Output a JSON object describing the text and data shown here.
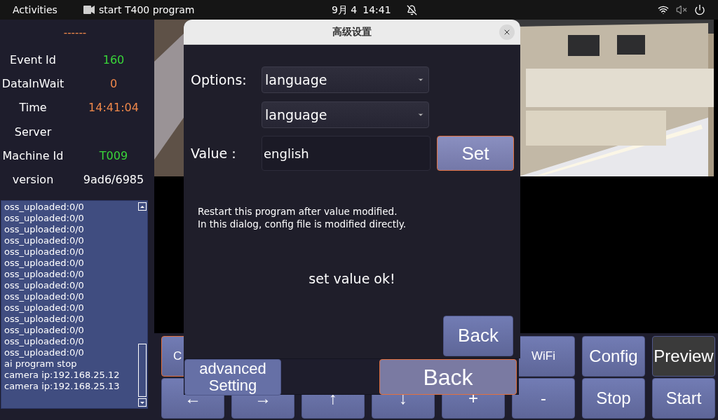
{
  "top_bar": {
    "activities": "Activities",
    "app_title": "start T400 program",
    "date": "9月 4",
    "time": "14:41"
  },
  "status_panel": {
    "header": "------",
    "rows": [
      {
        "label": "Event Id",
        "value": "160",
        "color": "#39d639"
      },
      {
        "label": "DataInWait",
        "value": "0",
        "color": "#f0884a"
      },
      {
        "label": "Time",
        "value": "14:41:04",
        "color": "#f0884a"
      },
      {
        "label": "Server"
      },
      {
        "label": "Machine Id",
        "value": "T009",
        "color": "#39d639"
      },
      {
        "label": "version",
        "value": "9ad6/6985",
        "color": "#ffffff"
      }
    ]
  },
  "log": [
    "oss_uploaded:0/0",
    "oss_uploaded:0/0",
    "oss_uploaded:0/0",
    "oss_uploaded:0/0",
    "oss_uploaded:0/0",
    "oss_uploaded:0/0",
    "oss_uploaded:0/0",
    "oss_uploaded:0/0",
    "oss_uploaded:0/0",
    "oss_uploaded:0/0",
    "oss_uploaded:0/0",
    "oss_uploaded:0/0",
    "oss_uploaded:0/0",
    "oss_uploaded:0/0",
    "ai program stop",
    "camera ip:192.168.25.12",
    "camera ip:192.168.25.13"
  ],
  "controls": {
    "row1_left": [
      {
        "label": "C",
        "kind": "standard",
        "focused": true
      }
    ],
    "row1_right": [
      {
        "label": "WiFi",
        "kind": "standard",
        "focused": false
      },
      {
        "label": "Config",
        "kind": "standard",
        "focused": false
      },
      {
        "label": "Preview",
        "kind": "dark",
        "focused": false
      }
    ],
    "row2": [
      {
        "label": "←",
        "kind": "standard",
        "focused": false
      },
      {
        "label": "→",
        "kind": "standard",
        "focused": false
      },
      {
        "label": "↑",
        "kind": "standard",
        "focused": false
      },
      {
        "label": "↓",
        "kind": "standard",
        "focused": false
      },
      {
        "label": "+",
        "kind": "standard",
        "focused": false
      },
      {
        "label": "-",
        "kind": "standard",
        "focused": false
      },
      {
        "label": "Stop",
        "kind": "standard",
        "focused": false
      },
      {
        "label": "Start",
        "kind": "standard",
        "focused": false
      }
    ]
  },
  "back_window": {
    "setting_button": [
      "advanced",
      "Setting"
    ],
    "back_button": "Back"
  },
  "dialog": {
    "title": "高级设置",
    "options_label": "Options:",
    "option_1": "language",
    "option_2": "language",
    "value_label": "Value：",
    "value": "english",
    "set_button": "Set",
    "notes": [
      "Restart this program after value modified.",
      "In this dialog, config file is modified directly."
    ],
    "message": "set value ok!",
    "back_button": "Back"
  }
}
